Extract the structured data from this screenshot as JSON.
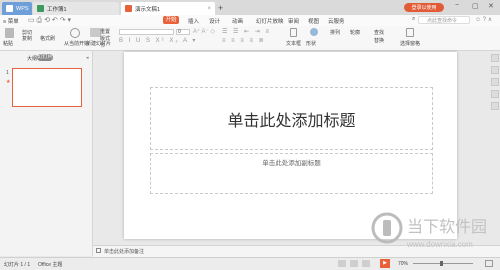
{
  "tabs": {
    "wps": "WPS",
    "sheet": "工作簿1",
    "ppt": "演示文稿1",
    "new_tab": "+"
  },
  "titlebar": {
    "login": "登录以使用",
    "window_controls": [
      "−",
      "▢",
      "✕"
    ]
  },
  "menubar": {
    "file_menu": "≡ 菜单",
    "items": [
      "开始",
      "插入",
      "设计",
      "动画",
      "幻灯片放映",
      "审阅",
      "视图",
      "云服务"
    ],
    "search_placeholder": "点此查找命令"
  },
  "ribbon": {
    "paste": "粘贴",
    "cut": "剪切",
    "copy": "复制",
    "format_painter": "格式刷",
    "from_current": "从当前开始",
    "new_slide": "新建幻灯片",
    "reset": "重置",
    "layout": "版式",
    "section": "节",
    "font_size": "0",
    "text_box": "文本框",
    "shapes": "形状",
    "arrange": "排列",
    "outline": "轮廓",
    "find": "查找",
    "replace": "替换",
    "select_pane": "选择窗格"
  },
  "leftpanel": {
    "outline_tab": "大纲",
    "slide_tab": "幻灯片",
    "slide_number": "1",
    "star": "★"
  },
  "slide": {
    "title_placeholder": "单击此处添加标题",
    "subtitle_placeholder": "单击此处添加副标题"
  },
  "notes": {
    "placeholder": "单击此处添加备注"
  },
  "statusbar": {
    "slide_count": "幻灯片 1 / 1",
    "theme": "Office 主题",
    "zoom": "70%"
  },
  "watermark": {
    "name": "当下软件园",
    "url": "www.downxia.com"
  },
  "colors": {
    "accent": "#e8613a",
    "wps_blue": "#6f9fd8"
  }
}
